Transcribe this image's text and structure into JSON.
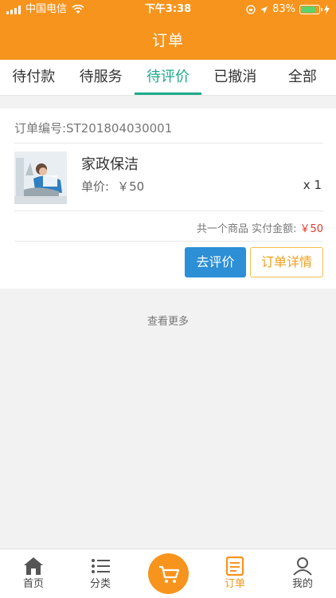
{
  "status_bar": {
    "carrier": "中国电信",
    "time": "下午3:38",
    "battery": "83%"
  },
  "header": {
    "title": "订单"
  },
  "tabs": [
    {
      "label": "待付款",
      "active": false
    },
    {
      "label": "待服务",
      "active": false
    },
    {
      "label": "待评价",
      "active": true
    },
    {
      "label": "已撤消",
      "active": false
    },
    {
      "label": "全部",
      "active": false
    }
  ],
  "order": {
    "number_label": "订单编号:ST201804030001",
    "item": {
      "name": "家政保洁",
      "price_label": "单价:",
      "price": "￥50",
      "quantity": "x 1"
    },
    "summary_text": "共一个商品 实付金额:",
    "total": "￥50",
    "buttons": {
      "review": "去评价",
      "detail": "订单详情"
    }
  },
  "see_more": "查看更多",
  "bottom_nav": [
    {
      "label": "首页",
      "icon": "home-icon"
    },
    {
      "label": "分类",
      "icon": "list-icon"
    },
    {
      "label": "",
      "icon": "cart-icon"
    },
    {
      "label": "订单",
      "icon": "order-icon",
      "active": true
    },
    {
      "label": "我的",
      "icon": "user-icon"
    }
  ],
  "colors": {
    "brand_orange": "#f7941d",
    "tab_active": "#1aab8a",
    "review_button": "#2d8fd6",
    "price_red": "#e23b2a"
  }
}
